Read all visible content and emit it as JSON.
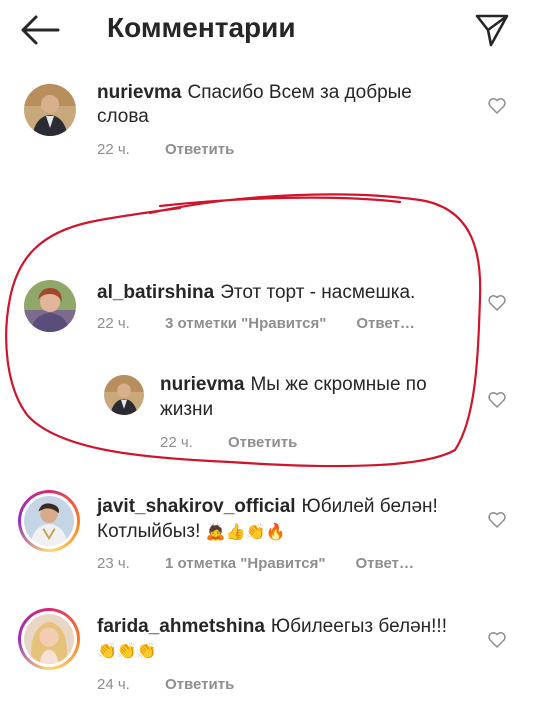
{
  "header": {
    "title": "Комментарии"
  },
  "comments": [
    {
      "username": "nurievma",
      "text_line1": "Спасибо Всем за добрые",
      "text_line2": "слова",
      "time": "22 ч.",
      "reply": "Ответить"
    },
    {
      "username": "al_batirshina",
      "text_line1": "Этот торт - насмешка.",
      "time": "22 ч.",
      "likes": "3 отметки \"Нравится\"",
      "reply": "Ответ…"
    },
    {
      "username": "nurievma",
      "text_line1": "Мы же скромные по",
      "text_line2": "жизни",
      "time": "22 ч.",
      "reply": "Ответить"
    },
    {
      "username": "javit_shakirov_official",
      "text_line1": "Юбилей белән!",
      "text_line2": "Котлыйбыз!",
      "time": "23 ч.",
      "likes": "1 отметка \"Нравится\"",
      "reply": "Ответ…"
    },
    {
      "username": "farida_ahmetshina",
      "text_line1": "Юбилеегыз белән!!!",
      "time": "24 ч.",
      "reply": "Ответить"
    }
  ],
  "colors": {
    "text": "#262626",
    "meta": "#8e8e8e",
    "annotation": "#d0142c"
  }
}
